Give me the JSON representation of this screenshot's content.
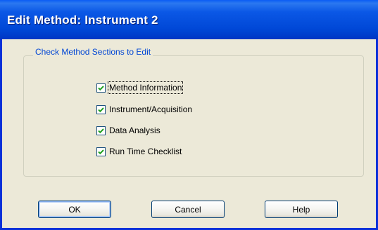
{
  "window": {
    "title": "Edit Method: Instrument 2"
  },
  "group": {
    "legend": "Check Method Sections to Edit",
    "options": [
      {
        "label": "Method Information",
        "checked": true
      },
      {
        "label": "Instrument/Acquisition",
        "checked": true
      },
      {
        "label": "Data Analysis",
        "checked": true
      },
      {
        "label": "Run Time Checklist",
        "checked": true
      }
    ]
  },
  "buttons": {
    "ok": "OK",
    "cancel": "Cancel",
    "help": "Help"
  },
  "colors": {
    "titlebar": "#0054e3",
    "group_legend": "#0046d5",
    "checkmark": "#21a121",
    "dialog_bg": "#ece9d8"
  }
}
